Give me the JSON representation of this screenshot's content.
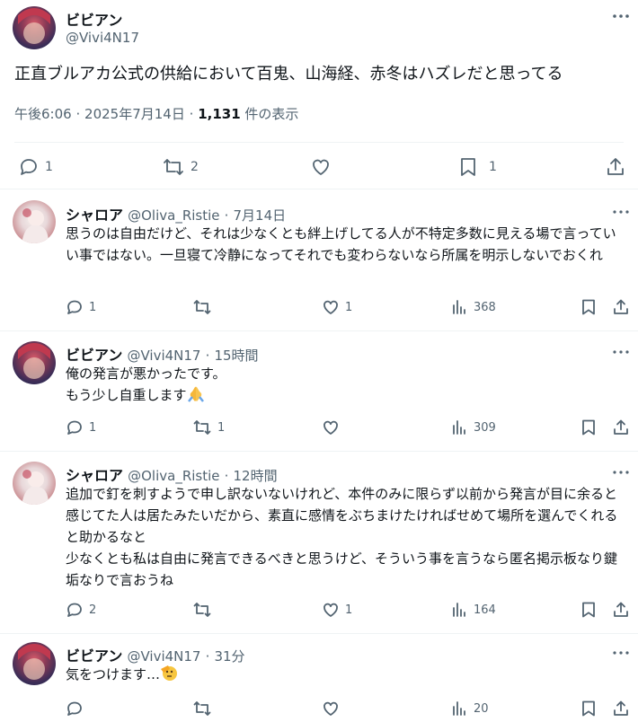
{
  "main_post": {
    "author_name": "ビビアン",
    "author_handle": "@Vivi4N17",
    "text": "正直ブルアカ公式の供給において百鬼、山海経、赤冬はハズレだと思ってる",
    "time": "午後6:06",
    "date": "2025年7月14日",
    "views_count": "1,131",
    "views_label": "件の表示",
    "replies": "1",
    "reposts": "2",
    "bookmarks": "1"
  },
  "replies": [
    {
      "author_name": "シャロア",
      "author_handle": "@Oliva_Ristie",
      "time": "7月14日",
      "text": "思うのは自由だけど、それは少なくとも絆上げしてる人が不特定多数に見える場で言っていい事ではない。一旦寝て冷静になってそれでも変わらないなら所属を明示しないでおくれ",
      "replies": "1",
      "reposts": "",
      "likes": "1",
      "views": "368"
    },
    {
      "author_name": "ビビアン",
      "author_handle": "@Vivi4N17",
      "time": "15時間",
      "line1": "俺の発言が悪かったです。",
      "line2": "もう少し自重します",
      "replies": "1",
      "reposts": "1",
      "likes": "",
      "views": "309"
    },
    {
      "author_name": "シャロア",
      "author_handle": "@Oliva_Ristie",
      "time": "12時間",
      "text": "追加で釘を刺すようで申し訳ないないけれど、本件のみに限らず以前から発言が目に余ると感じてた人は居たみたいだから、素直に感情をぶちまけたければせめて場所を選んでくれると助かるなと",
      "text2": "少なくとも私は自由に発言できるべきと思うけど、そういう事を言うなら匿名掲示板なり鍵垢なりで言おうね",
      "replies": "2",
      "reposts": "",
      "likes": "1",
      "views": "164"
    },
    {
      "author_name": "ビビアン",
      "author_handle": "@Vivi4N17",
      "time": "31分",
      "text": "気をつけます…",
      "replies": "",
      "reposts": "",
      "likes": "",
      "views": "20"
    }
  ],
  "separator": "·",
  "icons": [
    "more-icon",
    "reply-icon",
    "repost-icon",
    "like-icon",
    "bookmark-icon",
    "share-icon",
    "views-icon",
    "pray-emoji",
    "saluting-face-emoji"
  ]
}
